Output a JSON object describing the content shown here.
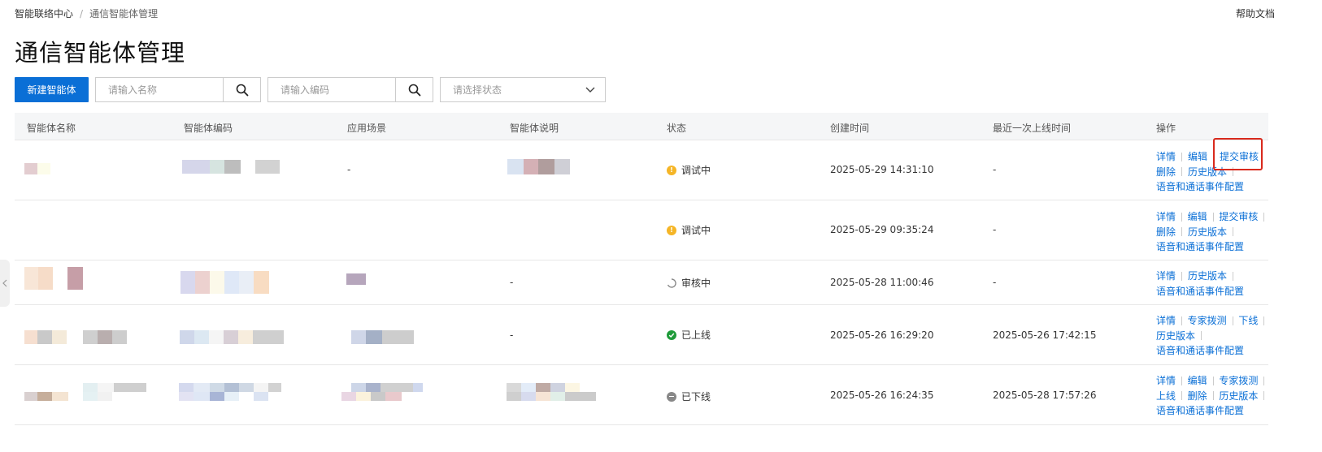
{
  "breadcrumb": {
    "root": "智能联络中心",
    "separator": "/",
    "current": "通信智能体管理"
  },
  "help_link": "帮助文档",
  "page_title": "通信智能体管理",
  "toolbar": {
    "new_button": "新建智能体",
    "name_search": {
      "placeholder": "请输入名称",
      "icon": "search-icon"
    },
    "code_search": {
      "placeholder": "请输入编码",
      "icon": "search-icon"
    },
    "status_select": {
      "placeholder": "请选择状态",
      "icon": "chevron-down-icon"
    }
  },
  "table": {
    "columns": [
      "智能体名称",
      "智能体编码",
      "应用场景",
      "智能体说明",
      "状态",
      "创建时间",
      "最近一次上线时间",
      "操作"
    ],
    "rows": [
      {
        "scene": "-",
        "description": "",
        "status": "调试中",
        "status_color": "#f5b526",
        "created": "2025-05-29 14:31:10",
        "last_online": "-",
        "ops": [
          [
            "详情",
            "编辑",
            "提交审核"
          ],
          [
            "删除",
            "历史版本"
          ],
          [
            "语音和通话事件配置"
          ]
        ]
      },
      {
        "scene": "",
        "description": "",
        "status": "调试中",
        "status_color": "#f5b526",
        "created": "2025-05-29 09:35:24",
        "last_online": "-",
        "ops": [
          [
            "详情",
            "编辑",
            "提交审核"
          ],
          [
            "删除",
            "历史版本"
          ],
          [
            "语音和通话事件配置"
          ]
        ]
      },
      {
        "scene": "",
        "description": "-",
        "status": "审核中",
        "status_color": "#999999",
        "created": "2025-05-28 11:00:46",
        "last_online": "-",
        "ops": [
          [
            "详情",
            "历史版本"
          ],
          [
            "语音和通话事件配置"
          ]
        ]
      },
      {
        "scene": "",
        "description": "-",
        "status": "已上线",
        "status_color": "#1f9b3a",
        "created": "2025-05-26 16:29:20",
        "last_online": "2025-05-26 17:42:15",
        "ops": [
          [
            "详情",
            "专家拨测",
            "下线"
          ],
          [
            "历史版本"
          ],
          [
            "语音和通话事件配置"
          ]
        ]
      },
      {
        "scene": "",
        "description": "",
        "status": "已下线",
        "status_color": "#888888",
        "created": "2025-05-26 16:24:35",
        "last_online": "2025-05-28 17:57:26",
        "ops": [
          [
            "详情",
            "编辑",
            "专家拨测"
          ],
          [
            "上线",
            "删除",
            "历史版本"
          ],
          [
            "语音和通话事件配置"
          ]
        ]
      }
    ]
  }
}
